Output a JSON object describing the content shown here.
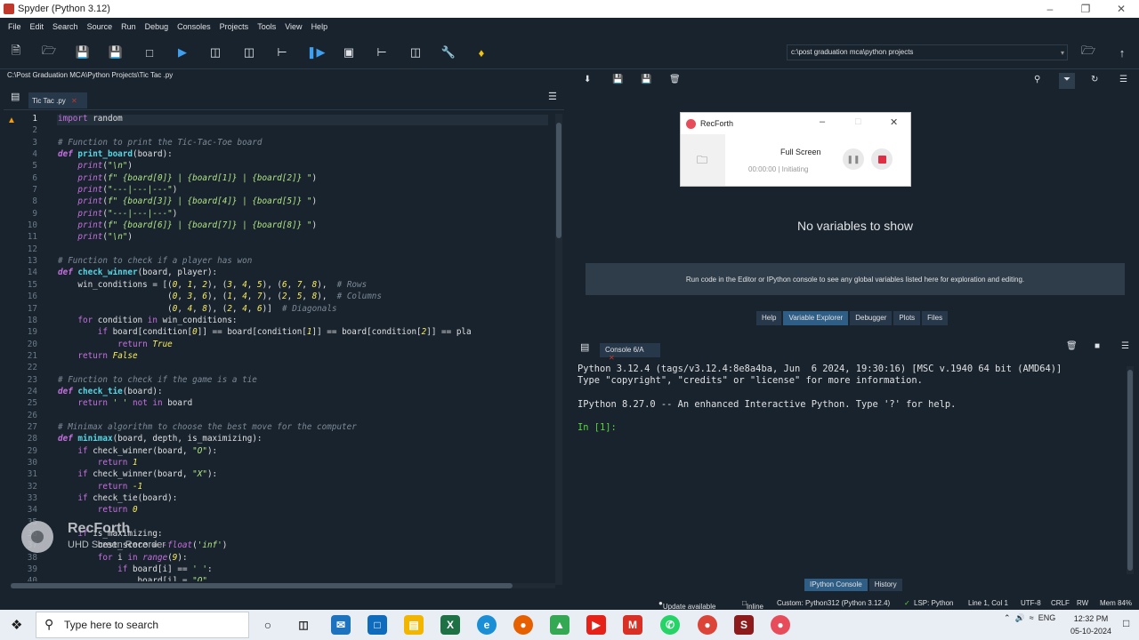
{
  "window": {
    "title": "Spyder (Python 3.12)"
  },
  "menu": [
    "File",
    "Edit",
    "Search",
    "Source",
    "Run",
    "Debug",
    "Consoles",
    "Projects",
    "Tools",
    "View",
    "Help"
  ],
  "toolbar": {
    "icons": [
      "new-file-icon",
      "open-folder-icon",
      "save-icon",
      "save-all-icon",
      "new-window-icon",
      "run-icon",
      "run-cell-icon",
      "run-cell-advance-icon",
      "run-selection-icon",
      "debug-icon",
      "maximize-pane-icon",
      "profile-icon",
      "layout-icon",
      "wrench-icon",
      "python-icon"
    ],
    "working_directory": "c:\\post graduation mca\\python projects"
  },
  "editor": {
    "file_path": "C:\\Post Graduation MCA\\Python Projects\\Tic Tac .py",
    "tab_label": "Tic Tac .py",
    "current_line": 1,
    "lines": [
      {
        "n": "1",
        "html": "<span class=\"imp\">import</span> random"
      },
      {
        "n": "2",
        "html": ""
      },
      {
        "n": "3",
        "html": "<span class=\"cm\"># Function to print the Tic-Tac-Toe board</span>"
      },
      {
        "n": "4",
        "html": "<span class=\"kw\">def</span> <span class=\"fn\">print_board</span>(board):"
      },
      {
        "n": "5",
        "html": "    <span class=\"bi\">print</span>(<span class=\"st\">\"\\n\"</span>)"
      },
      {
        "n": "6",
        "html": "    <span class=\"bi\">print</span>(<span class=\"st\">f\" {board[0]} | {board[1]} | {board[2]} \"</span>)"
      },
      {
        "n": "7",
        "html": "    <span class=\"bi\">print</span>(<span class=\"st\">\"---|---|---\"</span>)"
      },
      {
        "n": "8",
        "html": "    <span class=\"bi\">print</span>(<span class=\"st\">f\" {board[3]} | {board[4]} | {board[5]} \"</span>)"
      },
      {
        "n": "9",
        "html": "    <span class=\"bi\">print</span>(<span class=\"st\">\"---|---|---\"</span>)"
      },
      {
        "n": "10",
        "html": "    <span class=\"bi\">print</span>(<span class=\"st\">f\" {board[6]} | {board[7]} | {board[8]} \"</span>)"
      },
      {
        "n": "11",
        "html": "    <span class=\"bi\">print</span>(<span class=\"st\">\"\\n\"</span>)"
      },
      {
        "n": "12",
        "html": ""
      },
      {
        "n": "13",
        "html": "<span class=\"cm\"># Function to check if a player has won</span>"
      },
      {
        "n": "14",
        "html": "<span class=\"kw\">def</span> <span class=\"fn\">check_winner</span>(board, player):"
      },
      {
        "n": "15",
        "html": "    win_conditions = [(<span class=\"nm\">0</span>, <span class=\"nm\">1</span>, <span class=\"nm\">2</span>), (<span class=\"nm\">3</span>, <span class=\"nm\">4</span>, <span class=\"nm\">5</span>), (<span class=\"nm\">6</span>, <span class=\"nm\">7</span>, <span class=\"nm\">8</span>),  <span class=\"cm\"># Rows</span>"
      },
      {
        "n": "16",
        "html": "                      (<span class=\"nm\">0</span>, <span class=\"nm\">3</span>, <span class=\"nm\">6</span>), (<span class=\"nm\">1</span>, <span class=\"nm\">4</span>, <span class=\"nm\">7</span>), (<span class=\"nm\">2</span>, <span class=\"nm\">5</span>, <span class=\"nm\">8</span>),  <span class=\"cm\"># Columns</span>"
      },
      {
        "n": "17",
        "html": "                      (<span class=\"nm\">0</span>, <span class=\"nm\">4</span>, <span class=\"nm\">8</span>), (<span class=\"nm\">2</span>, <span class=\"nm\">4</span>, <span class=\"nm\">6</span>)]  <span class=\"cm\"># Diagonals</span>"
      },
      {
        "n": "18",
        "html": "    <span class=\"kwp\">for</span> condition <span class=\"kwp\">in</span> win_conditions:"
      },
      {
        "n": "19",
        "html": "        <span class=\"kwp\">if</span> board[condition[<span class=\"nm\">0</span>]] == board[condition[<span class=\"nm\">1</span>]] == board[condition[<span class=\"nm\">2</span>]] == pla"
      },
      {
        "n": "20",
        "html": "            <span class=\"kwp\">return</span> <span class=\"nm\">True</span>"
      },
      {
        "n": "21",
        "html": "    <span class=\"kwp\">return</span> <span class=\"nm\">False</span>"
      },
      {
        "n": "22",
        "html": ""
      },
      {
        "n": "23",
        "html": "<span class=\"cm\"># Function to check if the game is a tie</span>"
      },
      {
        "n": "24",
        "html": "<span class=\"kw\">def</span> <span class=\"fn\">check_tie</span>(board):"
      },
      {
        "n": "25",
        "html": "    <span class=\"kwp\">return</span> <span class=\"st\">' '</span> <span class=\"kwp\">not in</span> board"
      },
      {
        "n": "26",
        "html": ""
      },
      {
        "n": "27",
        "html": "<span class=\"cm\"># Minimax algorithm to choose the best move for the computer</span>"
      },
      {
        "n": "28",
        "html": "<span class=\"kw\">def</span> <span class=\"fn\">minimax</span>(board, depth, is_maximizing):"
      },
      {
        "n": "29",
        "html": "    <span class=\"kwp\">if</span> check_winner(board, <span class=\"st\">\"O\"</span>):"
      },
      {
        "n": "30",
        "html": "        <span class=\"kwp\">return</span> <span class=\"nm\">1</span>"
      },
      {
        "n": "31",
        "html": "    <span class=\"kwp\">if</span> check_winner(board, <span class=\"st\">\"X\"</span>):"
      },
      {
        "n": "32",
        "html": "        <span class=\"kwp\">return</span> <span class=\"nm\">-1</span>"
      },
      {
        "n": "33",
        "html": "    <span class=\"kwp\">if</span> check_tie(board):"
      },
      {
        "n": "34",
        "html": "        <span class=\"kwp\">return</span> <span class=\"nm\">0</span>"
      },
      {
        "n": "35",
        "html": ""
      },
      {
        "n": "36",
        "html": "    <span class=\"kwp\">if</span> is_maximizing:"
      },
      {
        "n": "37",
        "html": "        best_score = <span class=\"bi\">-float</span>(<span class=\"st\">'inf'</span>)"
      },
      {
        "n": "38",
        "html": "        <span class=\"kwp\">for</span> i <span class=\"kwp\">in</span> <span class=\"bi\">range</span>(<span class=\"nm\">9</span>):"
      },
      {
        "n": "39",
        "html": "            <span class=\"kwp\">if</span> board[i] == <span class=\"st\">' '</span>:"
      },
      {
        "n": "40",
        "html": "                board[i] = <span class=\"st\">\"O\"</span>"
      }
    ]
  },
  "variable_explorer": {
    "empty_title": "No variables to show",
    "hint": "Run code in the Editor or IPython console to see any global variables listed here for exploration and editing.",
    "tabs": [
      "Help",
      "Variable Explorer",
      "Debugger",
      "Plots",
      "Files"
    ],
    "active_tab": "Variable Explorer"
  },
  "recorder": {
    "title": "RecForth",
    "mode": "Full Screen",
    "time": "00:00:00",
    "state": "Initiating"
  },
  "console": {
    "tab_label": "Console 6/A",
    "lines": [
      "Python 3.12.4 (tags/v3.12.4:8e8a4ba, Jun  6 2024, 19:30:16) [MSC v.1940 64 bit (AMD64)]",
      "Type \"copyright\", \"credits\" or \"license\" for more information.",
      "",
      "IPython 8.27.0 -- An enhanced Interactive Python. Type '?' for help.",
      ""
    ],
    "prompt": "In [1]:",
    "bottom_tabs": [
      "IPython Console",
      "History"
    ],
    "active_bottom_tab": "IPython Console"
  },
  "status": {
    "update": "Update available",
    "inline": "Inline",
    "interpreter": "Custom: Python312 (Python 3.12.4)",
    "lsp": "LSP: Python",
    "position": "Line 1, Col 1",
    "encoding": "UTF-8",
    "eol": "CRLF",
    "rw": "RW",
    "mem": "Mem 84%"
  },
  "watermark": {
    "title": "RecForth",
    "subtitle": "UHD Screen Recorder"
  },
  "taskbar": {
    "search_placeholder": "Type here to search",
    "lang": "ENG",
    "time": "12:32 PM",
    "date": "05-10-2024"
  }
}
